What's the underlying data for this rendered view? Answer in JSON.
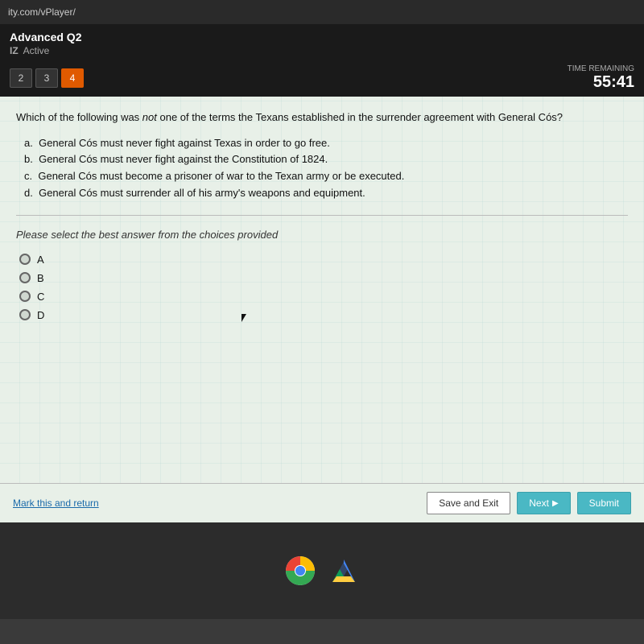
{
  "browser": {
    "url": "ity.com/vPlayer/"
  },
  "header": {
    "title": "Advanced Q2",
    "label": "IZ",
    "status": "Active"
  },
  "nav": {
    "buttons": [
      {
        "label": "2",
        "active": false
      },
      {
        "label": "3",
        "active": false
      },
      {
        "label": "4",
        "active": true
      }
    ],
    "timer_label": "TIME REMAINING",
    "timer_value": "55:41"
  },
  "question": {
    "text": "Which of the following was ",
    "italic": "not",
    "text2": " one of the terms the Texans established in the surrender agreement with General Cós?",
    "options": [
      {
        "letter": "a.",
        "text": "General Cós must never fight against Texas in order to go free."
      },
      {
        "letter": "b.",
        "text": "General Cós must never fight against the Constitution of 1824."
      },
      {
        "letter": "c.",
        "text": "General Cós must become a prisoner of war to the Texan army or be executed."
      },
      {
        "letter": "d.",
        "text": "General Cós must surrender all of his army's weapons and equipment."
      }
    ]
  },
  "answer": {
    "instruction": "Please select the best answer from the choices provided",
    "choices": [
      "A",
      "B",
      "C",
      "D"
    ]
  },
  "actions": {
    "mark_label": "Mark this and return",
    "save_exit": "Save and Exit",
    "next": "Next",
    "submit": "Submit"
  }
}
